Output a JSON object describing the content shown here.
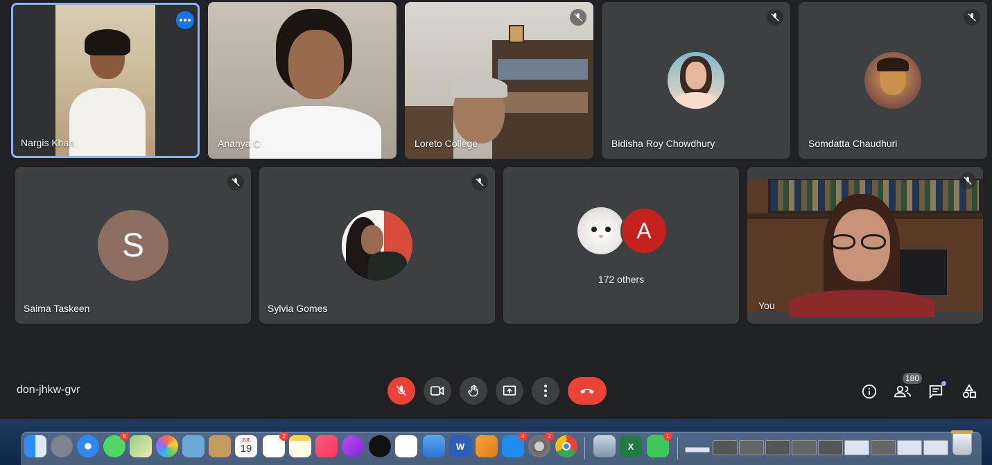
{
  "participants": [
    {
      "name": "Nargis Khan",
      "active": true
    },
    {
      "name": "Ananya C"
    },
    {
      "name": "Loreto College"
    },
    {
      "name": "Bidisha Roy Chowdhury"
    },
    {
      "name": "Somdatta Chaudhuri"
    },
    {
      "name": "Saima Taskeen",
      "initial": "S"
    },
    {
      "name": "Sylvia Gomes"
    },
    {
      "others_label": "172 others",
      "initial": "A"
    },
    {
      "name": "You"
    }
  ],
  "meeting": {
    "code": "don-jhkw-gvr",
    "people_count": "180"
  },
  "controls": [
    "mic-off",
    "camera",
    "raise-hand",
    "present",
    "more-options",
    "leave-call"
  ],
  "right_controls": [
    "meeting-details",
    "people",
    "chat",
    "activities"
  ],
  "dock": {
    "calendar_month": "JUL",
    "calendar_day": "19",
    "badges": {
      "messages": "6",
      "reminders": "2",
      "app_store": "4",
      "system_prefs": "2",
      "facetime": "1"
    },
    "excel_letter": "X",
    "word_letter": "W"
  },
  "colors": {
    "background": "#202124",
    "tile": "#3c4043",
    "accent_blue": "#1a73e8",
    "end_red": "#ea4335",
    "avatar_S": "#8d6e63",
    "avatar_A": "#c5221f"
  }
}
